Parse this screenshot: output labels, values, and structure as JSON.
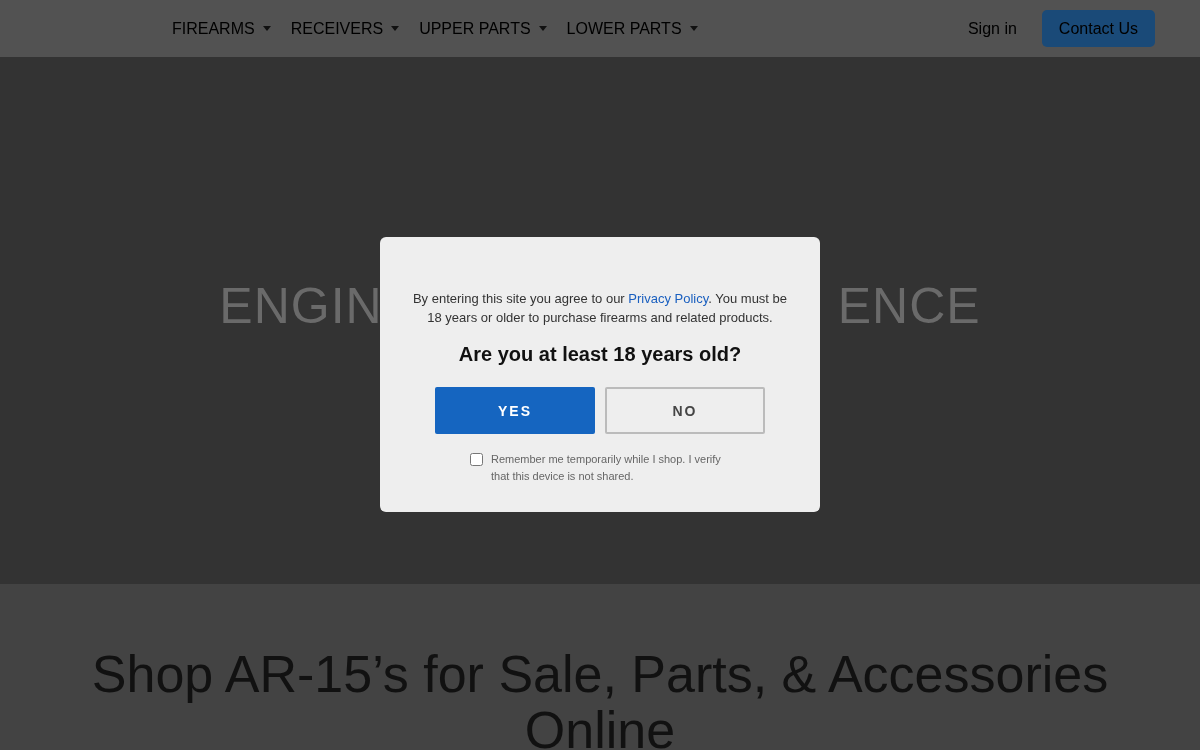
{
  "header": {
    "nav": [
      {
        "label": "FIREARMS"
      },
      {
        "label": "RECEIVERS"
      },
      {
        "label": "UPPER PARTS"
      },
      {
        "label": "LOWER PARTS"
      }
    ],
    "sign_in": "Sign in",
    "contact_button": "Contact Us"
  },
  "hero": {
    "title_visible_left": "ENGIN",
    "title_visible_right": "ENCE"
  },
  "age_modal": {
    "notice_before": "By entering this site you agree to our ",
    "notice_link": "Privacy Policy",
    "notice_after": ". You must be 18 years or older to purchase firearms and related products.",
    "question": "Are you at least 18 years old?",
    "buttons": [
      {
        "label": "YES",
        "kind": "primary"
      },
      {
        "label": "NO",
        "kind": "secondary"
      }
    ],
    "remember": {
      "label": "Remember me temporarily while I shop. I verify that this device is not shared.",
      "checked": false
    }
  },
  "section_heading": "Shop AR-15’s for Sale, Parts, & Accessories Online"
}
